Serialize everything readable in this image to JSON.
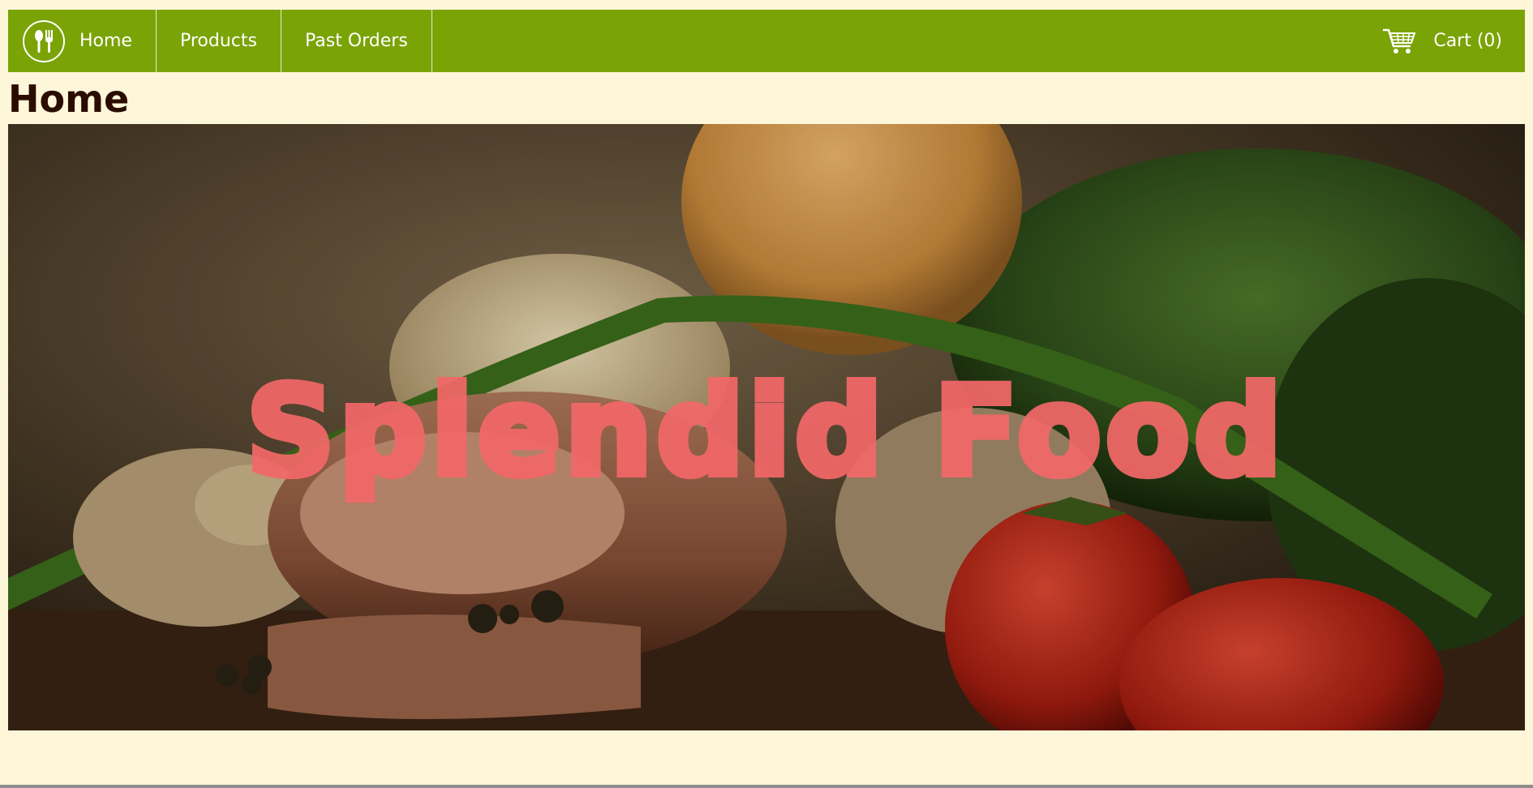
{
  "nav": {
    "home_label": "Home",
    "products_label": "Products",
    "past_orders_label": "Past Orders",
    "cart_label": "Cart (0)",
    "logo_icon": "fork-spoon-icon",
    "cart_icon": "shopping-cart-icon"
  },
  "page": {
    "title": "Home"
  },
  "hero": {
    "title": "Splendid Food"
  },
  "colors": {
    "nav_bg": "#7aa306",
    "page_bg": "#fdf6d8",
    "title_text": "#2a0d00",
    "hero_title": "#f26868"
  }
}
